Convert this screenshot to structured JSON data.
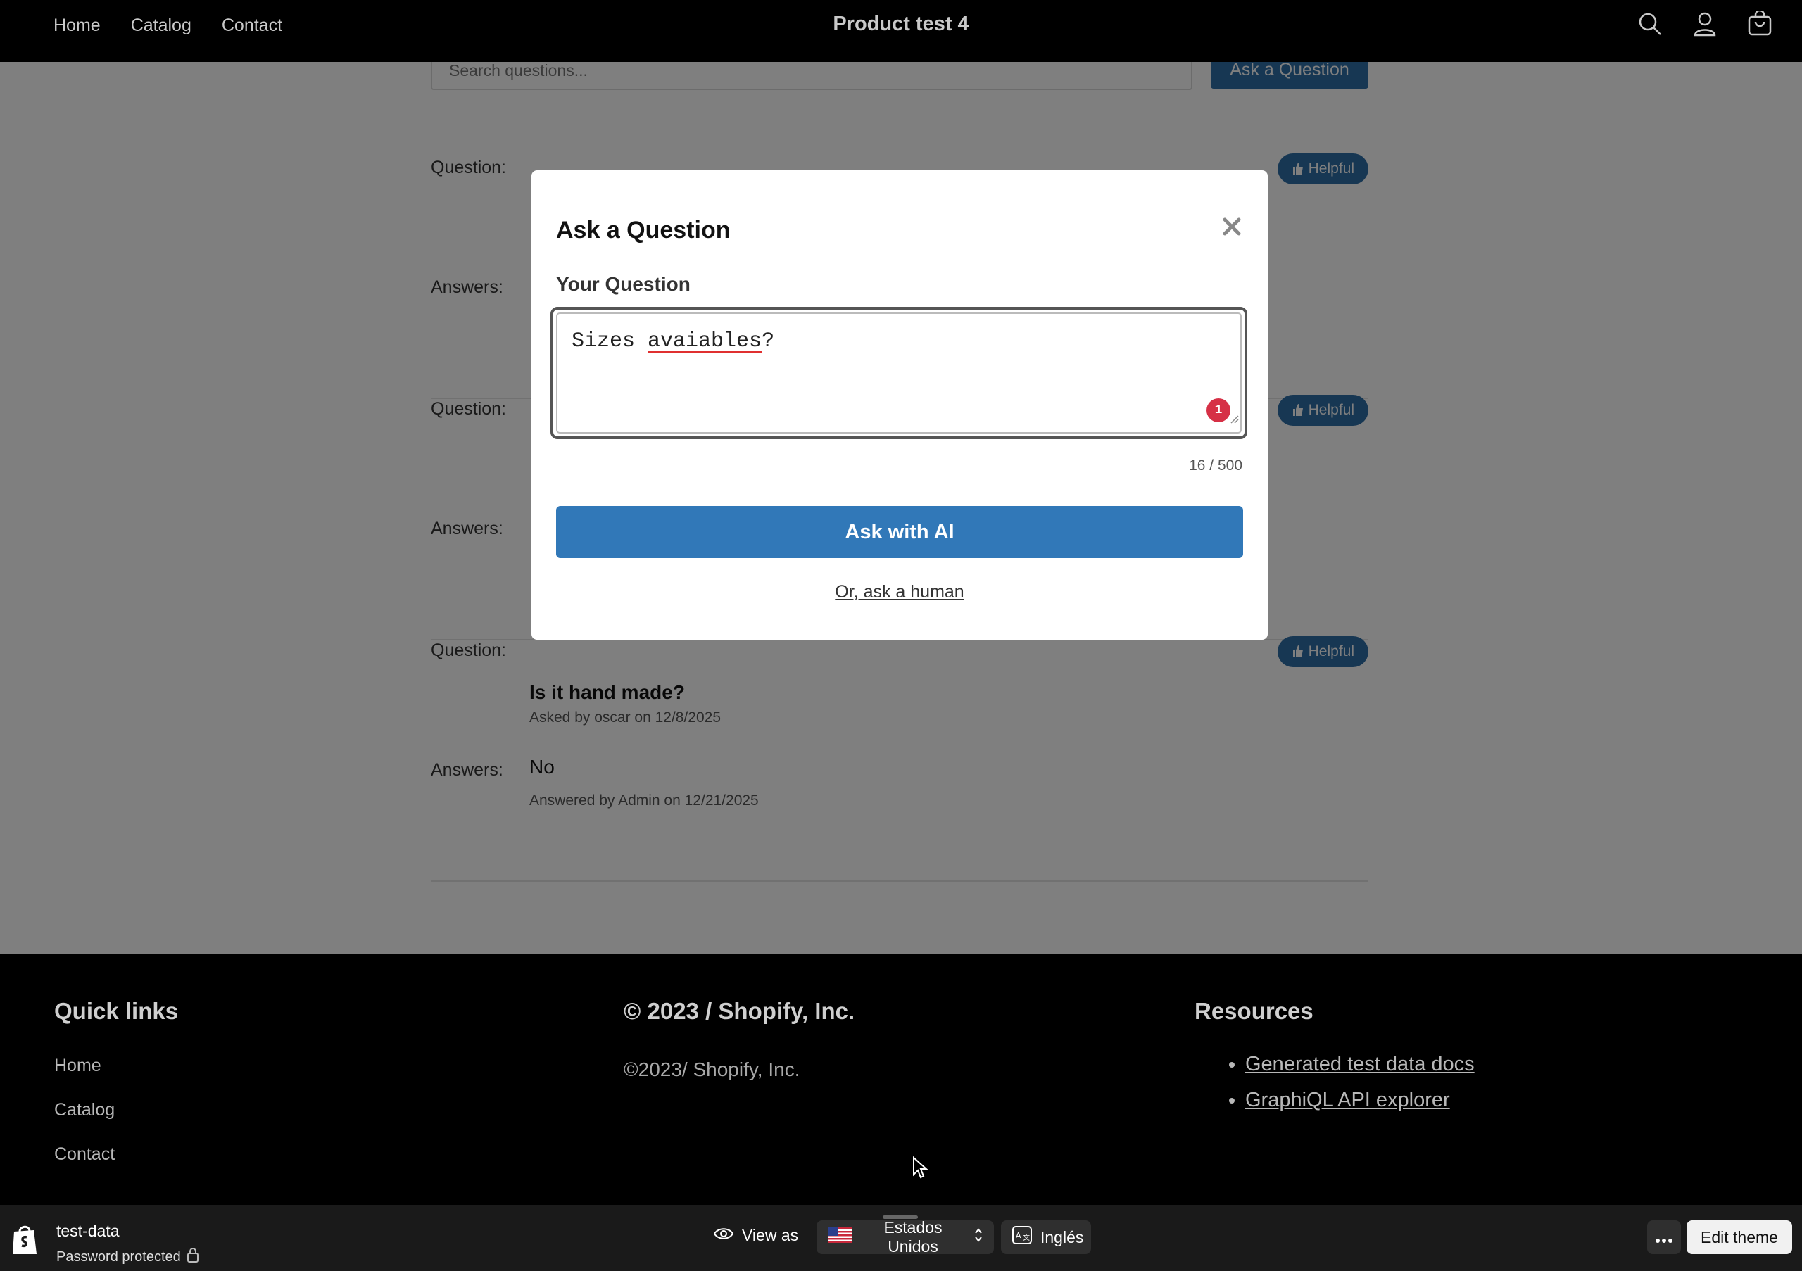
{
  "header": {
    "nav": [
      "Home",
      "Catalog",
      "Contact"
    ],
    "store_title": "Product test 4",
    "icons": [
      "search-icon",
      "account-icon",
      "cart-icon"
    ]
  },
  "questions_section": {
    "search_placeholder": "Search questions...",
    "ask_button": "Ask a Question",
    "question_label": "Question:",
    "answers_label": "Answers:",
    "helpful_label": "Helpful",
    "items": [
      {
        "question": "",
        "asked": "",
        "answer": "",
        "answered": ""
      },
      {
        "question": "",
        "asked": "",
        "answer": "",
        "answered": ""
      },
      {
        "question": "Is it hand made?",
        "asked": "Asked by oscar on 12/8/2025",
        "answer": "No",
        "answered": "Answered by Admin on 12/21/2025"
      }
    ]
  },
  "modal": {
    "title": "Ask a Question",
    "field_label": "Your Question",
    "value_word1": "Sizes",
    "value_word2": "avaiables",
    "value_punct": "?",
    "grammar_count": "1",
    "char_count": "16 / 500",
    "primary_button": "Ask with AI",
    "secondary_link": "Or, ask a human"
  },
  "footer": {
    "quick_links_heading": "Quick links",
    "quick_links": [
      "Home",
      "Catalog",
      "Contact"
    ],
    "copyright_heading": "© 2023 / Shopify, Inc.",
    "copyright_text": "©2023/ Shopify, Inc.",
    "resources_heading": "Resources",
    "resources": [
      "Generated test data docs",
      "GraphiQL API explorer"
    ]
  },
  "admin_bar": {
    "store_name": "test-data",
    "password_status": "Password protected",
    "view_as": "View as",
    "country": "Estados Unidos",
    "language": "Inglés",
    "edit_theme": "Edit theme"
  },
  "colors": {
    "accent_blue": "#3178b8",
    "header_bg": "#000000",
    "admin_bar_bg": "#1a1a1a",
    "badge_red": "#d63046"
  }
}
